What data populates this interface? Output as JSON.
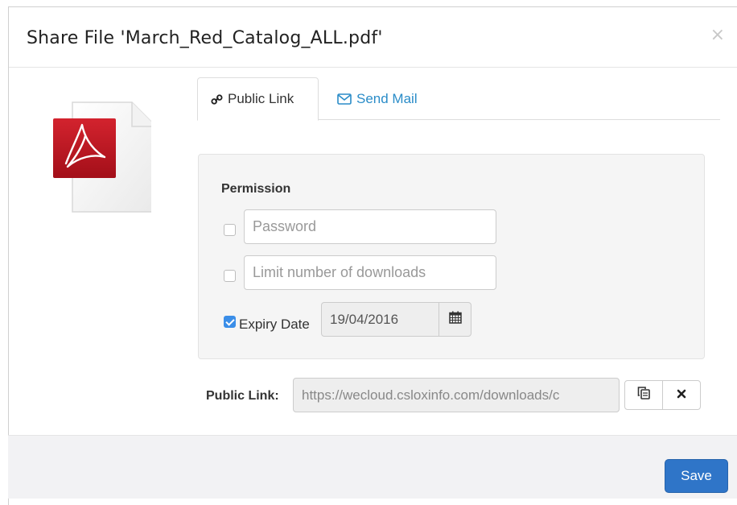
{
  "dialog": {
    "title": "Share File 'March_Red_Catalog_ALL.pdf'",
    "close_symbol": "×"
  },
  "file": {
    "icon": "pdf-file-icon",
    "brand_color": "#c8102e"
  },
  "tabs": [
    {
      "label": "Public Link",
      "icon": "link-icon",
      "active": true
    },
    {
      "label": "Send Mail",
      "icon": "envelope-icon",
      "active": false
    }
  ],
  "permission": {
    "heading": "Permission",
    "password": {
      "checked": false,
      "placeholder": "Password",
      "value": ""
    },
    "limit_downloads": {
      "checked": false,
      "placeholder": "Limit number of downloads",
      "value": ""
    },
    "expiry": {
      "checked": true,
      "label": "Expiry Date",
      "value": "19/04/2016",
      "icon": "calendar-icon"
    }
  },
  "public_link": {
    "label": "Public Link:",
    "value": "https://wecloud.csloxinfo.com/downloads/c",
    "copy_icon": "copy-icon",
    "remove_icon": "times-icon"
  },
  "footer": {
    "save_label": "Save"
  },
  "colors": {
    "accent": "#2f75c8",
    "link": "#2a8cc8",
    "checkbox": "#3b8ee8"
  }
}
